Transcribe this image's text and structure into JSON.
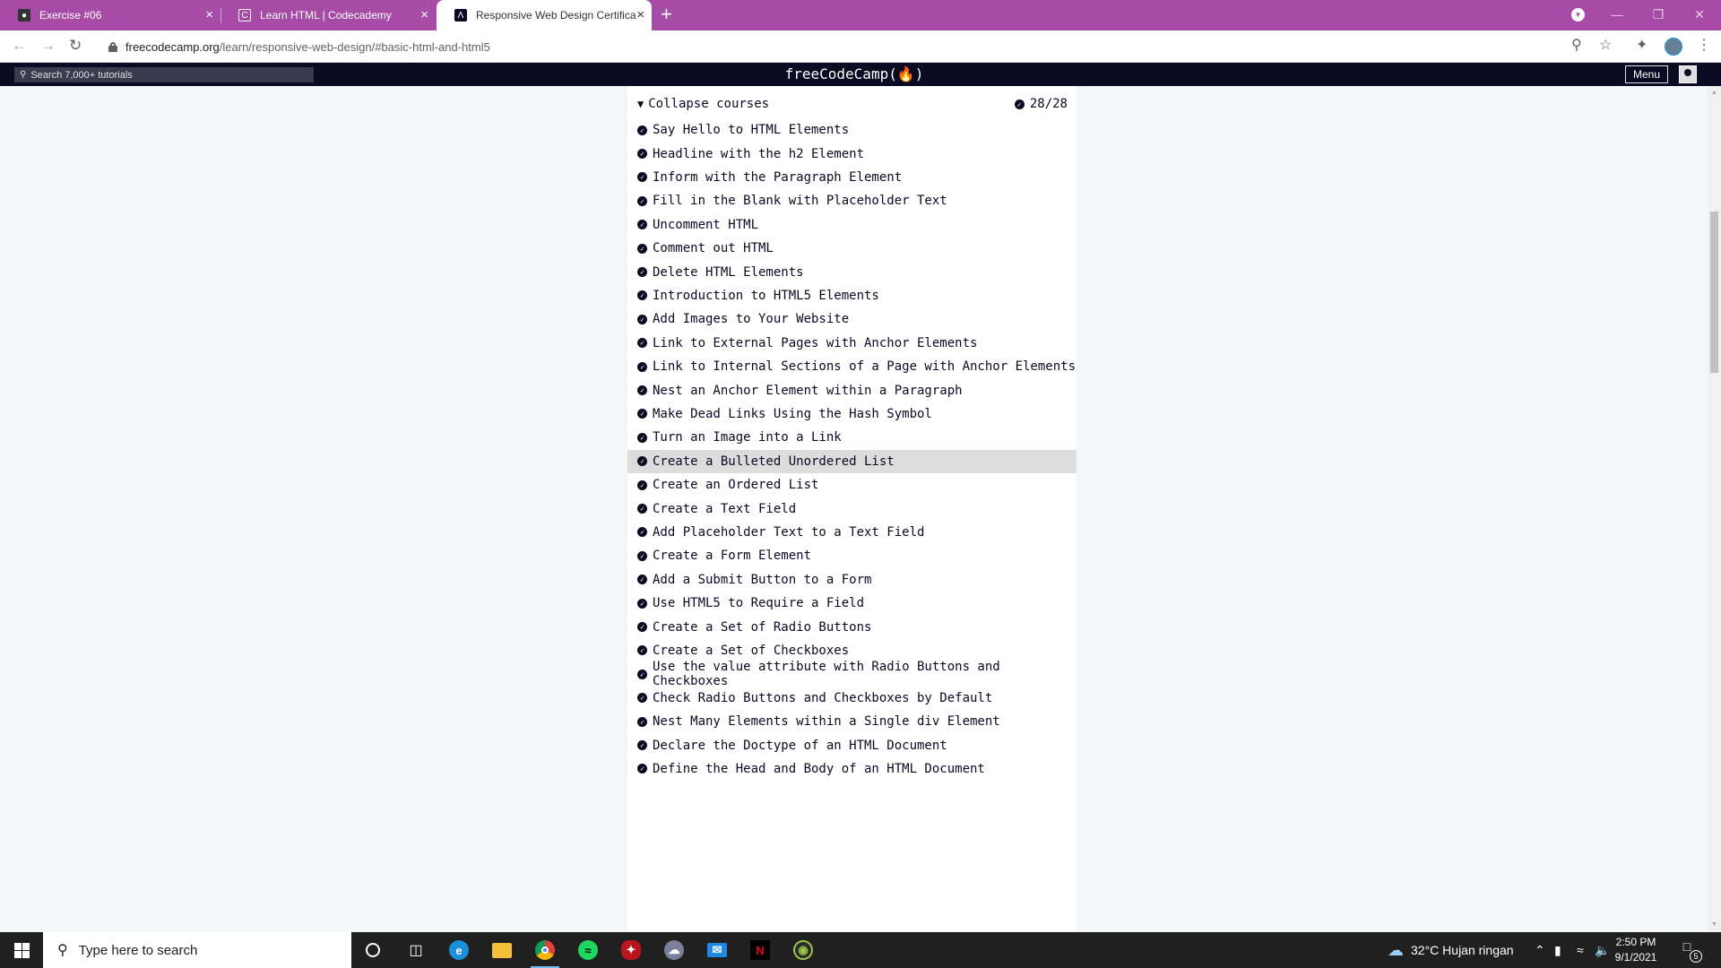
{
  "browser": {
    "tabs": [
      {
        "title": "Exercise #06",
        "icon": "user-doc-icon"
      },
      {
        "title": "Learn HTML | Codecademy",
        "icon": "codecademy-icon"
      },
      {
        "title": "Responsive Web Design Certifica",
        "icon": "freecodecamp-icon"
      }
    ],
    "url_host": "freecodecamp.org",
    "url_path": "/learn/responsive-web-design/#basic-html-and-html5"
  },
  "fcc": {
    "search_placeholder": "Search 7,000+ tutorials",
    "logo": "freeCodeCamp(🔥)",
    "menu_label": "Menu"
  },
  "course": {
    "collapse_label": "Collapse courses",
    "progress": "28/28",
    "items": [
      "Say Hello to HTML Elements",
      "Headline with the h2 Element",
      "Inform with the Paragraph Element",
      "Fill in the Blank with Placeholder Text",
      "Uncomment HTML",
      "Comment out HTML",
      "Delete HTML Elements",
      "Introduction to HTML5 Elements",
      "Add Images to Your Website",
      "Link to External Pages with Anchor Elements",
      "Link to Internal Sections of a Page with Anchor Elements",
      "Nest an Anchor Element within a Paragraph",
      "Make Dead Links Using the Hash Symbol",
      "Turn an Image into a Link",
      "Create a Bulleted Unordered List",
      "Create an Ordered List",
      "Create a Text Field",
      "Add Placeholder Text to a Text Field",
      "Create a Form Element",
      "Add a Submit Button to a Form",
      "Use HTML5 to Require a Field",
      "Create a Set of Radio Buttons",
      "Create a Set of Checkboxes",
      "Use the value attribute with Radio Buttons and Checkboxes",
      "Check Radio Buttons and Checkboxes by Default",
      "Nest Many Elements within a Single div Element",
      "Declare the Doctype of an HTML Document",
      "Define the Head and Body of an HTML Document"
    ],
    "highlighted_item": "Create a Bulleted Unordered List"
  },
  "taskbar": {
    "search_placeholder": "Type here to search",
    "weather": "32°C  Hujan ringan",
    "time": "2:50 PM",
    "date": "9/1/2021",
    "notification_count": "5"
  }
}
